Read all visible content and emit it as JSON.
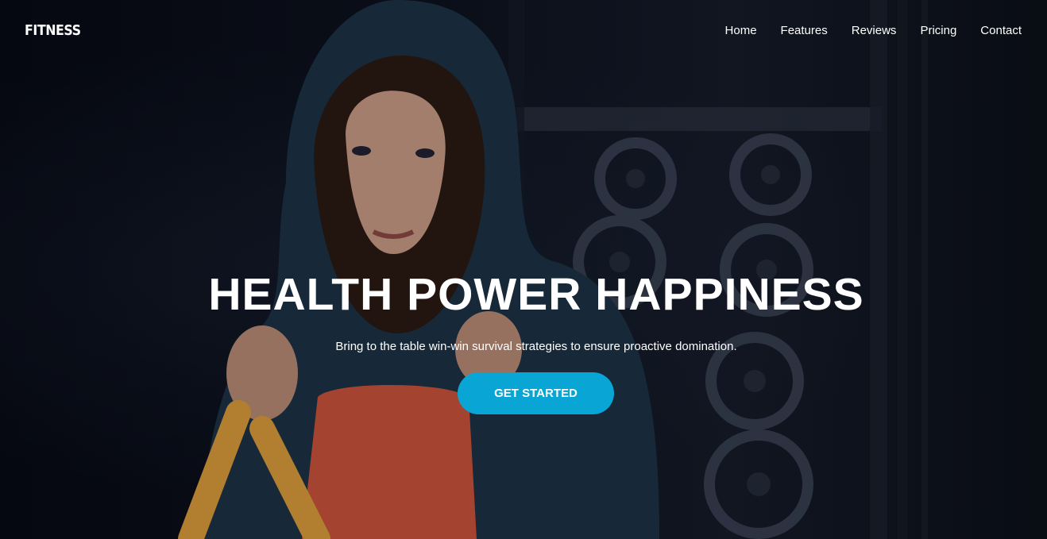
{
  "brand": {
    "name": "FITNESS"
  },
  "nav": {
    "items": [
      "Home",
      "Features",
      "Reviews",
      "Pricing",
      "Contact"
    ]
  },
  "hero": {
    "headline": "HEALTH POWER HAPPINESS",
    "subtitle": "Bring to the table win-win survival strategies to ensure proactive domination.",
    "cta_label": "GET STARTED"
  },
  "colors": {
    "accent": "#09a5d4",
    "text": "#ffffff",
    "background": "#0b0f1a"
  },
  "background_image": {
    "subject": "woman in dark hooded jacket and orange top holding yellow battle ropes in a gym with weight plates"
  }
}
